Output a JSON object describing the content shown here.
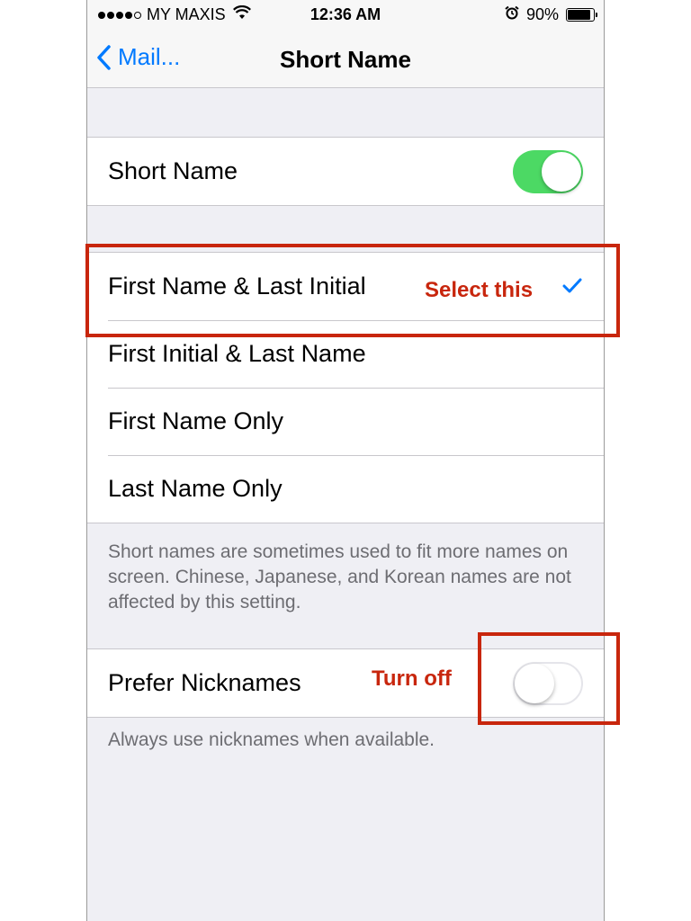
{
  "status_bar": {
    "carrier": "MY MAXIS",
    "time": "12:36 AM",
    "battery": "90%",
    "battery_level": 0.9,
    "signal_bars_filled": 4,
    "signal_bars_total": 5,
    "icons": [
      "signal-dots-icon",
      "wifi-icon",
      "alarm-icon",
      "battery-icon"
    ]
  },
  "nav": {
    "back_label": "Mail...",
    "title": "Short Name",
    "back_icon": "chevron-left-icon"
  },
  "short_name_setting": {
    "label": "Short Name",
    "enabled": true
  },
  "format_options": [
    {
      "label": "First Name & Last Initial",
      "selected": true
    },
    {
      "label": "First Initial & Last Name",
      "selected": false
    },
    {
      "label": "First Name Only",
      "selected": false
    },
    {
      "label": "Last Name Only",
      "selected": false
    }
  ],
  "format_footer": "Short names are sometimes used to fit more names on screen. Chinese, Japanese, and Korean names are not affected by this setting.",
  "prefer_nicknames": {
    "label": "Prefer Nicknames",
    "enabled": false,
    "footer": "Always use nicknames when available."
  },
  "annotations": {
    "select_label": "Select this",
    "turnoff_label": "Turn off",
    "color": "#c8260d"
  },
  "colors": {
    "accent": "#007aff",
    "toggle_on": "#4cd964",
    "background": "#efeff4"
  }
}
